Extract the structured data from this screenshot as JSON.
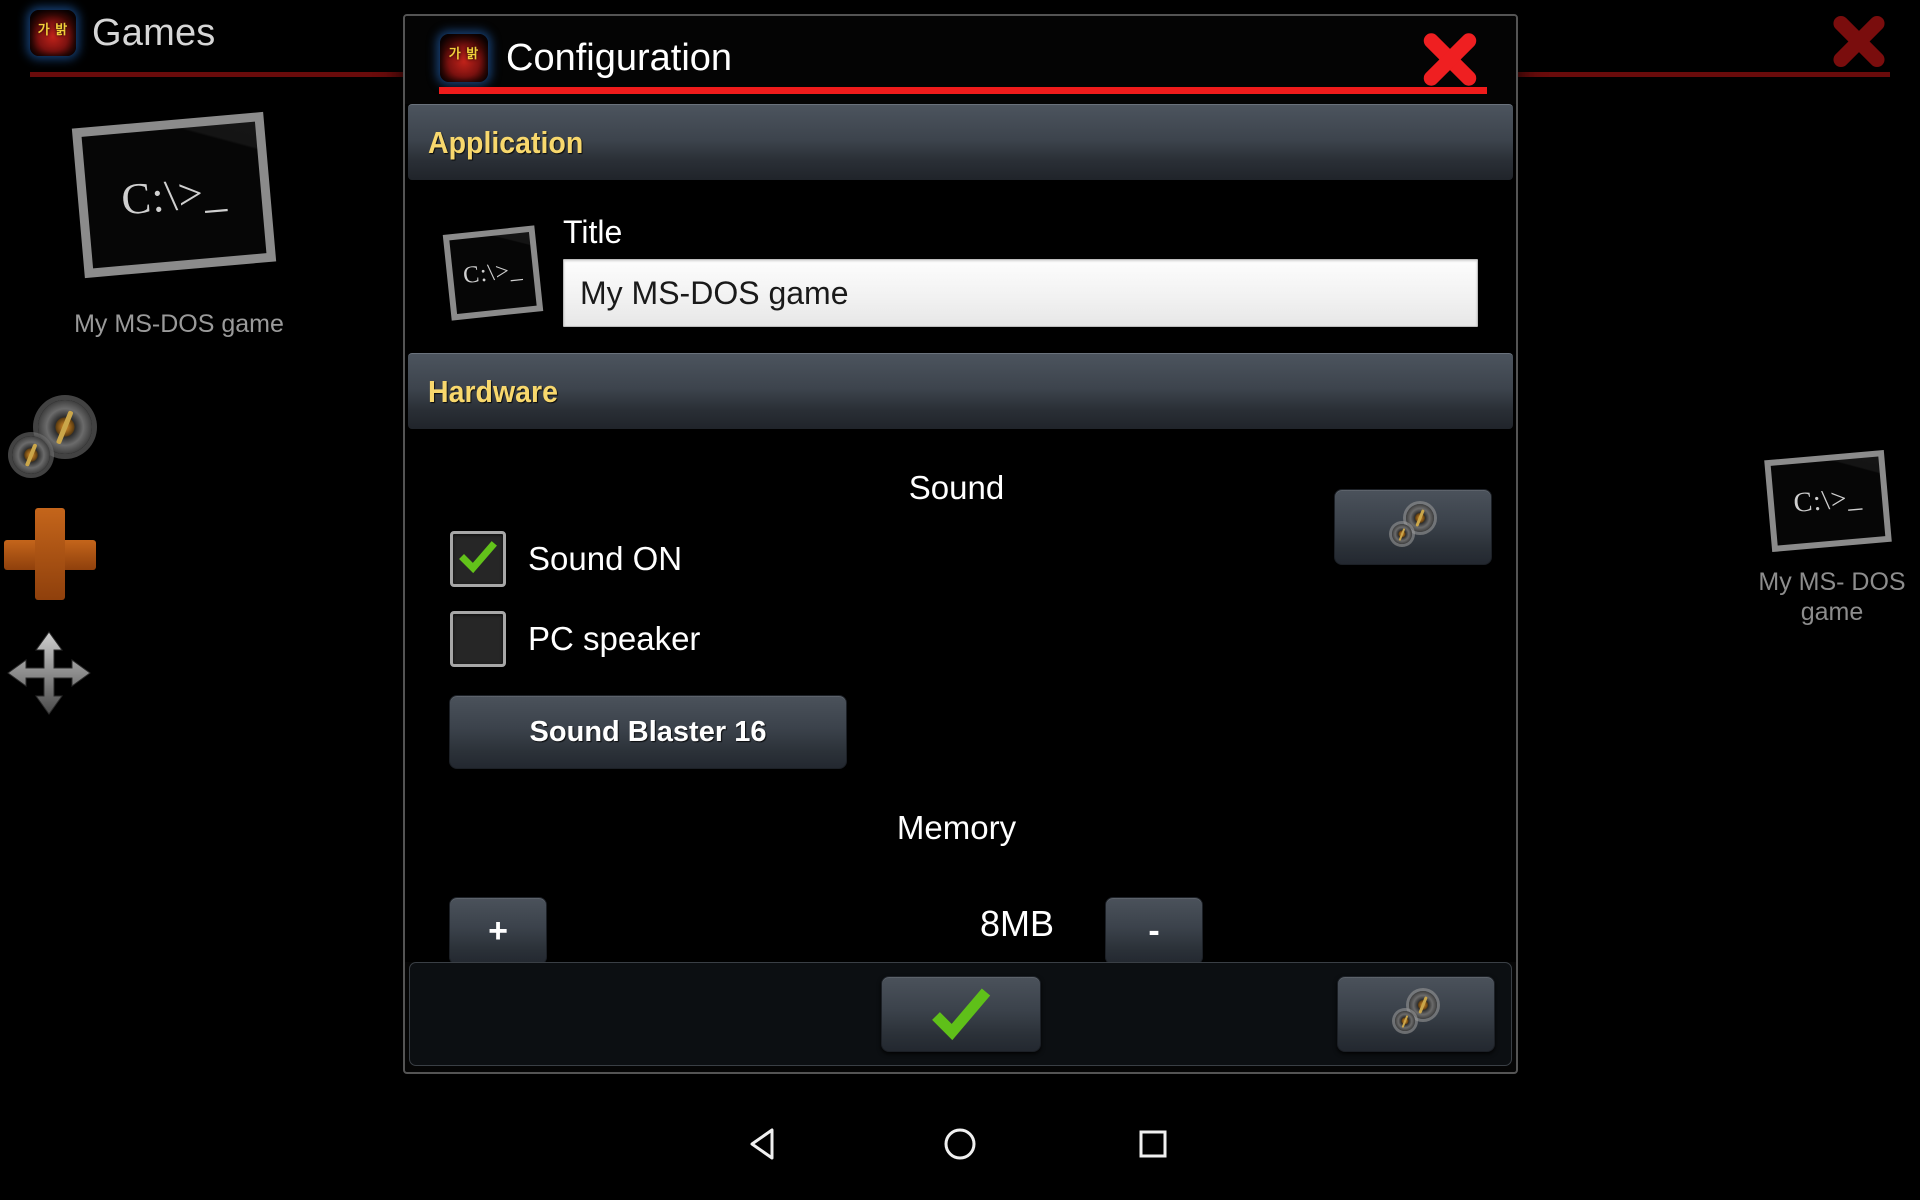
{
  "launcher": {
    "app_icon": "app-orb-icon",
    "title": "Games",
    "close_icon": "close-x-icon",
    "items": [
      {
        "icon": "ms-dos-prompt-icon",
        "prompt": "C:\\>_",
        "label": "My MS-DOS game"
      },
      {
        "icon": "ms-dos-prompt-icon",
        "prompt": "C:\\>_",
        "label": "My MS-\nDOS game"
      }
    ],
    "toolbar": [
      {
        "name": "settings-gears-icon"
      },
      {
        "name": "add-plus-icon"
      },
      {
        "name": "move-arrows-icon"
      }
    ]
  },
  "dialog": {
    "app_icon": "app-orb-icon",
    "title": "Configuration",
    "close_icon": "close-x-icon",
    "sections": [
      {
        "id": "application",
        "label": "Application"
      },
      {
        "id": "hardware",
        "label": "Hardware"
      }
    ],
    "application": {
      "icon": "ms-dos-prompt-icon",
      "icon_prompt": "C:\\>_",
      "title_label": "Title",
      "title_value": "My MS-DOS game",
      "title_placeholder": "Title"
    },
    "hardware": {
      "sound": {
        "group_label": "Sound",
        "settings_icon": "gears-icon",
        "checkboxes": [
          {
            "label": "Sound ON",
            "checked": true
          },
          {
            "label": "PC speaker",
            "checked": false
          }
        ],
        "card_button": "Sound Blaster 16"
      },
      "memory": {
        "group_label": "Memory",
        "increase_label": "+",
        "value": "8MB",
        "decrease_label": "-"
      }
    },
    "footer": {
      "ok_icon": "check-icon",
      "settings_icon": "gears-icon"
    }
  },
  "navbar": {
    "back": "back-triangle-icon",
    "home": "home-circle-icon",
    "recents": "recents-square-icon"
  },
  "colors": {
    "accent_red": "#ef1b1b",
    "section_label_gold": "#f8d86d",
    "check_green": "#62c21a",
    "plus_orange": "#c4651b"
  }
}
